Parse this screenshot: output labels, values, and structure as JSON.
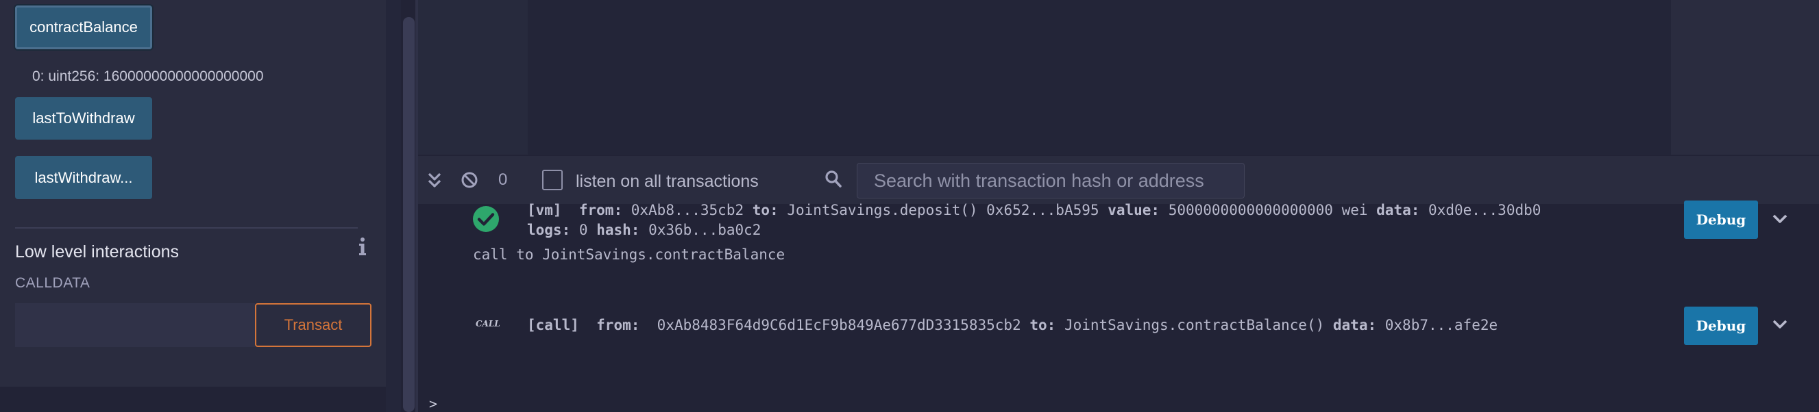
{
  "left_panel": {
    "buttons": {
      "contract_balance": "contractBalance",
      "last_to_withdraw": "lastToWithdraw",
      "last_withdraw": "lastWithdraw..."
    },
    "result": "0: uint256: 16000000000000000000",
    "low_level": {
      "title": "Low level interactions",
      "calldata_label": "CALLDATA",
      "calldata_value": "",
      "transact_label": "Transact"
    }
  },
  "terminal": {
    "pending_count": "0",
    "listen_label": "listen on all transactions",
    "listen_checked": false,
    "search_placeholder": "Search with transaction hash or address",
    "tx1": {
      "tag": "[vm]",
      "from_label": "from:",
      "from": "0xAb8...35cb2",
      "to_label": "to:",
      "to": "JointSavings.deposit() 0x652...bA595",
      "value_label": "value:",
      "value": "5000000000000000000 wei",
      "data_label": "data:",
      "data": "0xd0e...30db0",
      "logs_label": "logs:",
      "logs": "0",
      "hash_label": "hash:",
      "hash": "0x36b...ba0c2",
      "status_icon": "check-circle-icon"
    },
    "call_text": "call to JointSavings.contractBalance",
    "tx2": {
      "badge": "CALL",
      "tag": "[call]",
      "from_label": "from:",
      "from": "0xAb8483F64d9C6d1EcF9b849Ae677dD3315835cb2",
      "to_label": "to:",
      "to": "JointSavings.contractBalance()",
      "data_label": "data:",
      "data": "0x8b7...afe2e"
    },
    "debug_label": "Debug",
    "prompt": ">"
  },
  "colors": {
    "background": "#222336",
    "panel": "#2a2c3f",
    "function_button": "#2e5a78",
    "transact_accent": "#d4753a",
    "debug_button": "#1a75a8",
    "success": "#2ea76c"
  }
}
